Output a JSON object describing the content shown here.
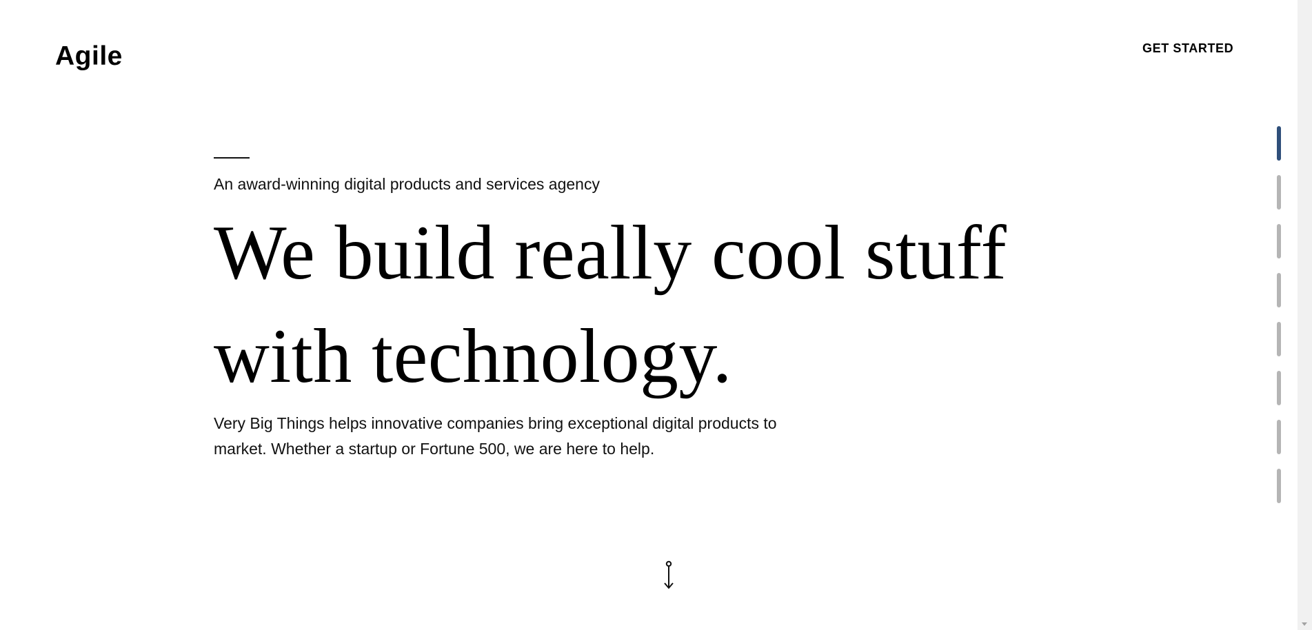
{
  "header": {
    "logo": "Agile",
    "cta_label": "GET STARTED"
  },
  "hero": {
    "eyebrow": "An award-winning digital products and services agency",
    "headline_line1": "We build really cool stuff",
    "headline_line2": "with technology.",
    "intro": "Very Big Things helps innovative companies bring exceptional digital products to market. Whether a startup or Fortune 500, we are here to help."
  },
  "scroll_hint": {
    "icon": "scroll-down-arrow-icon"
  },
  "side_nav": {
    "count": 8,
    "active_index": 0,
    "active_color": "#2f4f7a",
    "inactive_color": "#b5b5b5"
  }
}
